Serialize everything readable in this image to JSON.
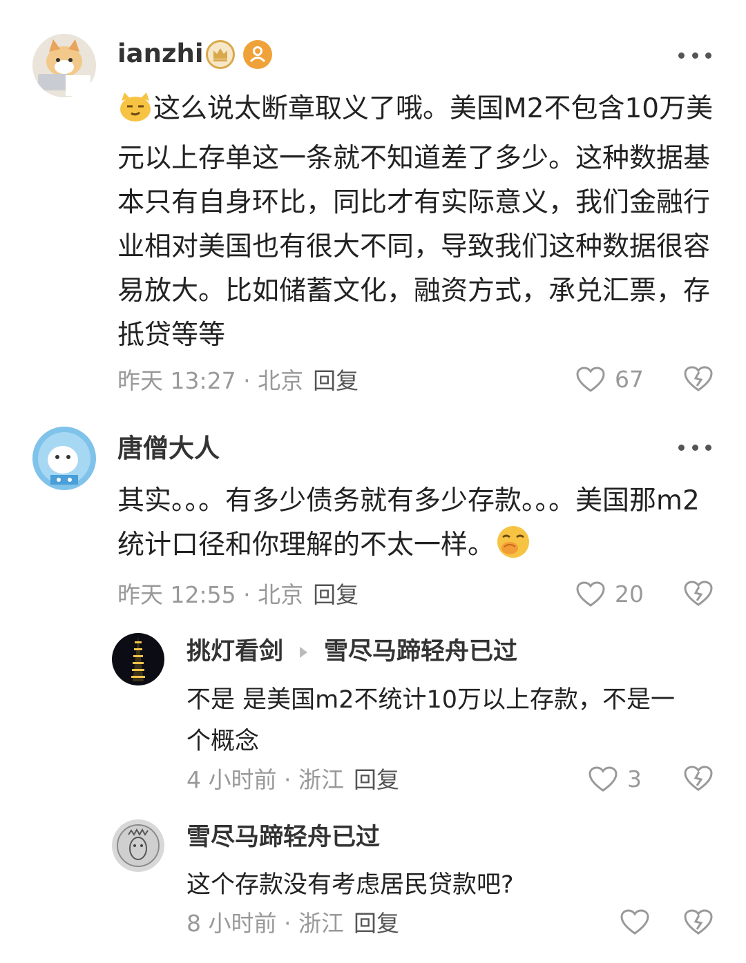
{
  "comments": [
    {
      "username": "ianzhi",
      "text": "这么说太断章取义了哦。美国M2不包含10万美元以上存单这一条就不知道差了多少。这种数据基本只有自身环比，同比才有实际意义，我们金融行业相对美国也有很大不同，导致我们这种数据很容易放大。比如储蓄文化，融资方式，承兑汇票，存抵贷等等",
      "time": "昨天 13:27",
      "location": "北京",
      "reply_label": "回复",
      "likes": "67"
    },
    {
      "username": "唐僧大人",
      "text": "其实。。。有多少债务就有多少存款。。。美国那m2统计口径和你理解的不太一样。",
      "time": "昨天 12:55",
      "location": "北京",
      "reply_label": "回复",
      "likes": "20",
      "replies": [
        {
          "username": "挑灯看剑",
          "reply_to": "雪尽马蹄轻舟已过",
          "text": "不是 是美国m2不统计10万以上存款，不是一个概念",
          "time": "4 小时前",
          "location": "浙江",
          "reply_label": "回复",
          "likes": "3"
        },
        {
          "username": "雪尽马蹄轻舟已过",
          "text": "这个存款没有考虑居民贷款吧?",
          "time": "8 小时前",
          "location": "浙江",
          "reply_label": "回复",
          "likes": ""
        }
      ]
    }
  ],
  "colors": {
    "meta_text": "#999999",
    "badge_gold": "#d9a84a",
    "badge_orange": "#f0a23a"
  },
  "icons": {
    "more": "more-horizontal-icon",
    "like": "heart-outline-icon",
    "dislike": "broken-heart-icon",
    "emoji_1": "cat-smirk-emoji",
    "emoji_2": "giggle-emoji"
  }
}
